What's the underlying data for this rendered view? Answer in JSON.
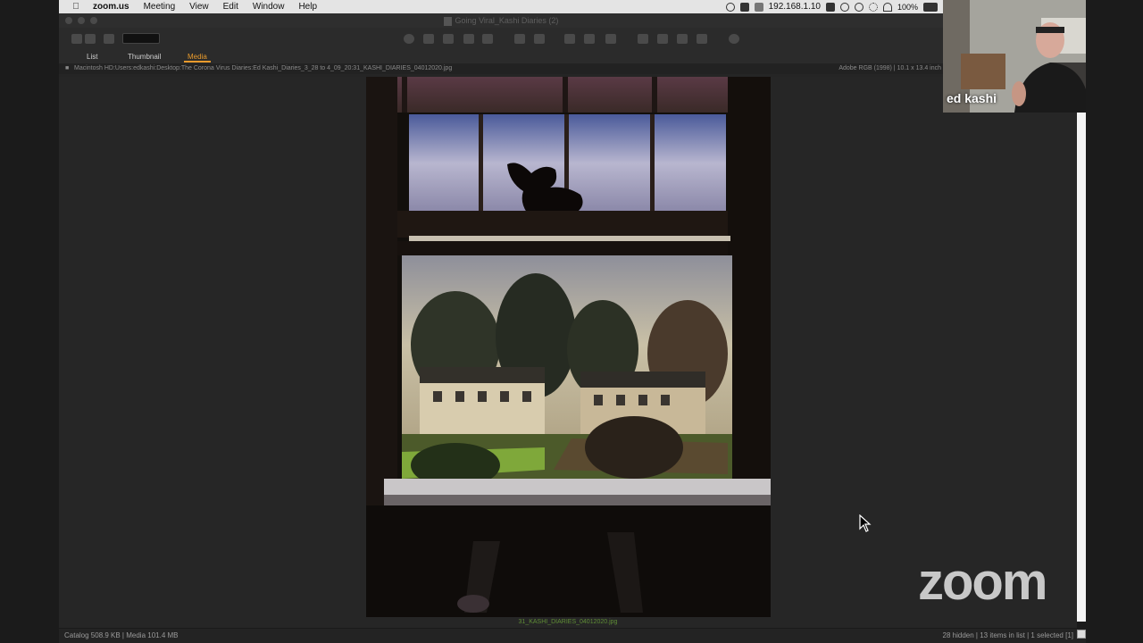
{
  "menubar": {
    "app_name": "zoom.us",
    "items": [
      "Meeting",
      "View",
      "Edit",
      "Window",
      "Help"
    ],
    "ip_address": "192.168.1.10",
    "battery": "100%"
  },
  "window": {
    "title": "Going Viral_Kashi Diaries (2)"
  },
  "tabs": [
    {
      "label": "List",
      "active": false
    },
    {
      "label": "Thumbnail",
      "active": false
    },
    {
      "label": "Media",
      "active": true
    }
  ],
  "path": "Macintosh HD:Users:edkashi:Desktop:The Corona Virus Diaries:Ed Kashi_Diaries_3_28 to 4_09_20:31_KASHI_DIARIES_04012020.jpg",
  "image_meta": "Adobe RGB (1998)  |  10.1 x 13.4 inch",
  "filename": "31_KASHI_DIARIES_04012020.jpg",
  "status": {
    "left": "Catalog  508.9 KB  |  Media 101.4 MB",
    "right": "28 hidden  |  13 items in list  |  1 selected [1]"
  },
  "participant": {
    "name": "ed kashi"
  },
  "zoom_logo": "zoom",
  "colors": {
    "accent_tab": "#e89a2c",
    "filename_green": "#5f8d36",
    "window_bg": "#252525"
  }
}
